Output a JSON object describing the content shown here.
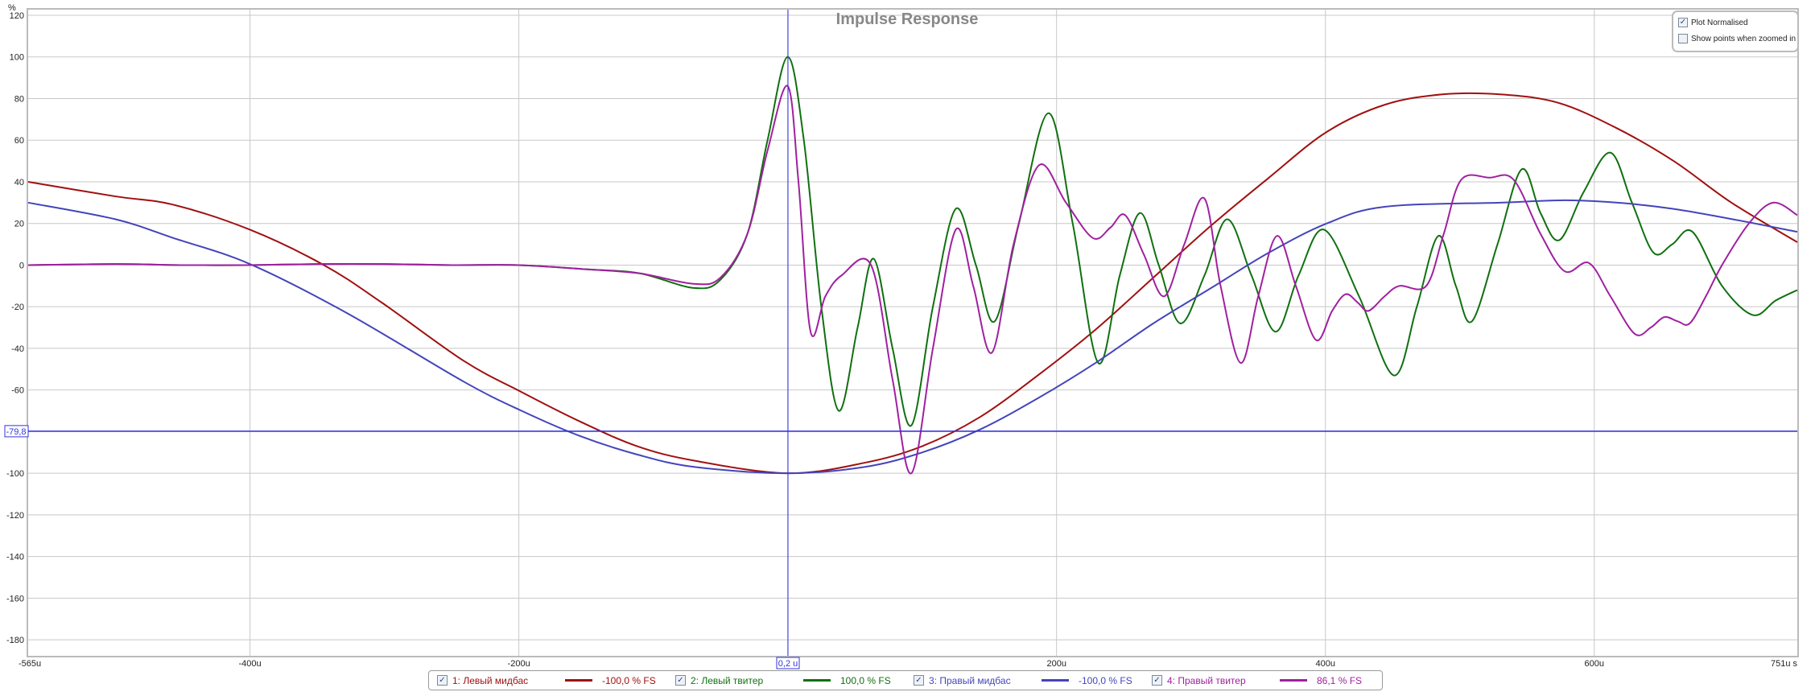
{
  "chart_data": {
    "type": "line",
    "title": "Impulse Response",
    "ylabel": "%",
    "xlabel": "s",
    "xlim": [
      -565,
      751
    ],
    "ylim": [
      -190,
      120
    ],
    "grid": true,
    "y_ticks": [
      120,
      100,
      80,
      60,
      40,
      20,
      0,
      -20,
      -40,
      -60,
      -80,
      -100,
      -120,
      -140,
      -160,
      -180
    ],
    "x_ticks": [
      {
        "value": -565,
        "label": "-565u"
      },
      {
        "value": -400,
        "label": "-400u"
      },
      {
        "value": -200,
        "label": "-200u"
      },
      {
        "value": 200,
        "label": "200u"
      },
      {
        "value": 400,
        "label": "400u"
      },
      {
        "value": 600,
        "label": "600u"
      },
      {
        "value": 751,
        "label": "751u s"
      }
    ],
    "x_gridlines": [
      -400,
      -200,
      0,
      200,
      400,
      600
    ],
    "cursor": {
      "x": 0.2,
      "x_label": "0,2 u",
      "y": -79.8,
      "y_label": "-79,8",
      "color": "#3333dd"
    },
    "series": [
      {
        "name": "1: Левый мидбас",
        "value_label": "-100,0 % FS",
        "color": "#a01010",
        "points": [
          [
            -565,
            40
          ],
          [
            -500,
            33
          ],
          [
            -457,
            29
          ],
          [
            -400,
            17
          ],
          [
            -345,
            0
          ],
          [
            -302,
            -18
          ],
          [
            -241,
            -46
          ],
          [
            -198,
            -61
          ],
          [
            -155,
            -75
          ],
          [
            -112,
            -87
          ],
          [
            -69,
            -94
          ],
          [
            0,
            -100
          ],
          [
            57,
            -95
          ],
          [
            100,
            -87
          ],
          [
            143,
            -73
          ],
          [
            186,
            -53
          ],
          [
            229,
            -31
          ],
          [
            272,
            -6
          ],
          [
            315,
            19
          ],
          [
            358,
            42
          ],
          [
            401,
            64
          ],
          [
            444,
            77
          ],
          [
            487,
            82
          ],
          [
            530,
            82
          ],
          [
            573,
            78
          ],
          [
            616,
            66
          ],
          [
            659,
            50
          ],
          [
            702,
            30
          ],
          [
            751,
            11
          ]
        ]
      },
      {
        "name": "2: Левый твитер",
        "value_label": "100,0 % FS",
        "color": "#107010",
        "points": [
          [
            -565,
            0
          ],
          [
            -500,
            0.5
          ],
          [
            -450,
            0
          ],
          [
            -400,
            0
          ],
          [
            -350,
            0.5
          ],
          [
            -300,
            0.5
          ],
          [
            -250,
            0
          ],
          [
            -200,
            0
          ],
          [
            -150,
            -2
          ],
          [
            -110,
            -4
          ],
          [
            -70,
            -11
          ],
          [
            -50,
            -7
          ],
          [
            -30,
            15
          ],
          [
            -15,
            60
          ],
          [
            0,
            100
          ],
          [
            12,
            60
          ],
          [
            25,
            -20
          ],
          [
            38,
            -70
          ],
          [
            52,
            -30
          ],
          [
            64,
            3
          ],
          [
            78,
            -40
          ],
          [
            92,
            -77
          ],
          [
            108,
            -20
          ],
          [
            125,
            27
          ],
          [
            140,
            0
          ],
          [
            154,
            -27
          ],
          [
            172,
            20
          ],
          [
            194,
            73
          ],
          [
            212,
            20
          ],
          [
            231,
            -47
          ],
          [
            247,
            -5
          ],
          [
            262,
            25
          ],
          [
            276,
            0
          ],
          [
            292,
            -28
          ],
          [
            310,
            -5
          ],
          [
            327,
            22
          ],
          [
            345,
            -5
          ],
          [
            363,
            -32
          ],
          [
            380,
            -5
          ],
          [
            399,
            17
          ],
          [
            425,
            -15
          ],
          [
            451,
            -53
          ],
          [
            468,
            -20
          ],
          [
            484,
            14
          ],
          [
            497,
            -10
          ],
          [
            509,
            -27
          ],
          [
            528,
            10
          ],
          [
            546,
            46
          ],
          [
            560,
            25
          ],
          [
            574,
            12
          ],
          [
            592,
            35
          ],
          [
            612,
            54
          ],
          [
            628,
            30
          ],
          [
            644,
            6
          ],
          [
            658,
            10
          ],
          [
            673,
            16
          ],
          [
            695,
            -10
          ],
          [
            718,
            -24
          ],
          [
            735,
            -17
          ],
          [
            751,
            -12
          ]
        ]
      },
      {
        "name": "3: Правый мидбас",
        "value_label": "-100,0 % FS",
        "color": "#4444bb",
        "points": [
          [
            -565,
            30
          ],
          [
            -500,
            22
          ],
          [
            -457,
            13
          ],
          [
            -400,
            0.5
          ],
          [
            -328,
            -23
          ],
          [
            -241,
            -56
          ],
          [
            -198,
            -70
          ],
          [
            -155,
            -82
          ],
          [
            -112,
            -91
          ],
          [
            -69,
            -97
          ],
          [
            0,
            -100
          ],
          [
            57,
            -97
          ],
          [
            100,
            -90
          ],
          [
            143,
            -79
          ],
          [
            186,
            -64
          ],
          [
            229,
            -47
          ],
          [
            272,
            -28
          ],
          [
            315,
            -11
          ],
          [
            358,
            6
          ],
          [
            401,
            20
          ],
          [
            444,
            28
          ],
          [
            530,
            30
          ],
          [
            590,
            31
          ],
          [
            659,
            27
          ],
          [
            751,
            16
          ]
        ]
      },
      {
        "name": "4: Правый твитер",
        "value_label": "86,1 % FS",
        "color": "#a020a0",
        "points": [
          [
            -565,
            0
          ],
          [
            -500,
            0.5
          ],
          [
            -450,
            0
          ],
          [
            -400,
            0
          ],
          [
            -350,
            0.5
          ],
          [
            -300,
            0.5
          ],
          [
            -250,
            0
          ],
          [
            -200,
            0
          ],
          [
            -150,
            -2
          ],
          [
            -110,
            -4
          ],
          [
            -70,
            -9
          ],
          [
            -50,
            -6
          ],
          [
            -30,
            15
          ],
          [
            -15,
            55
          ],
          [
            0,
            86
          ],
          [
            8,
            40
          ],
          [
            17,
            -32
          ],
          [
            28,
            -15
          ],
          [
            40,
            -5
          ],
          [
            62,
            0
          ],
          [
            78,
            -55
          ],
          [
            92,
            -100
          ],
          [
            108,
            -40
          ],
          [
            125,
            17
          ],
          [
            138,
            -10
          ],
          [
            152,
            -42
          ],
          [
            168,
            10
          ],
          [
            187,
            48
          ],
          [
            207,
            30
          ],
          [
            227,
            13
          ],
          [
            240,
            18
          ],
          [
            251,
            24
          ],
          [
            265,
            5
          ],
          [
            280,
            -15
          ],
          [
            295,
            10
          ],
          [
            310,
            32
          ],
          [
            322,
            -10
          ],
          [
            337,
            -47
          ],
          [
            350,
            -15
          ],
          [
            364,
            14
          ],
          [
            378,
            -10
          ],
          [
            393,
            -36
          ],
          [
            405,
            -22
          ],
          [
            415,
            -14
          ],
          [
            424,
            -18
          ],
          [
            432,
            -22
          ],
          [
            444,
            -15
          ],
          [
            455,
            -10
          ],
          [
            475,
            -10
          ],
          [
            488,
            15
          ],
          [
            501,
            41
          ],
          [
            522,
            42
          ],
          [
            540,
            41
          ],
          [
            560,
            15
          ],
          [
            578,
            -3
          ],
          [
            596,
            1
          ],
          [
            612,
            -15
          ],
          [
            630,
            -33
          ],
          [
            642,
            -30
          ],
          [
            652,
            -25
          ],
          [
            662,
            -27
          ],
          [
            671,
            -28
          ],
          [
            683,
            -15
          ],
          [
            695,
            0
          ],
          [
            715,
            20
          ],
          [
            733,
            30
          ],
          [
            751,
            24
          ]
        ]
      }
    ]
  },
  "options": {
    "plot_normalised": {
      "label": "Plot Normalised",
      "checked": true
    },
    "show_points": {
      "label": "Show points when zoomed in",
      "checked": false
    }
  }
}
